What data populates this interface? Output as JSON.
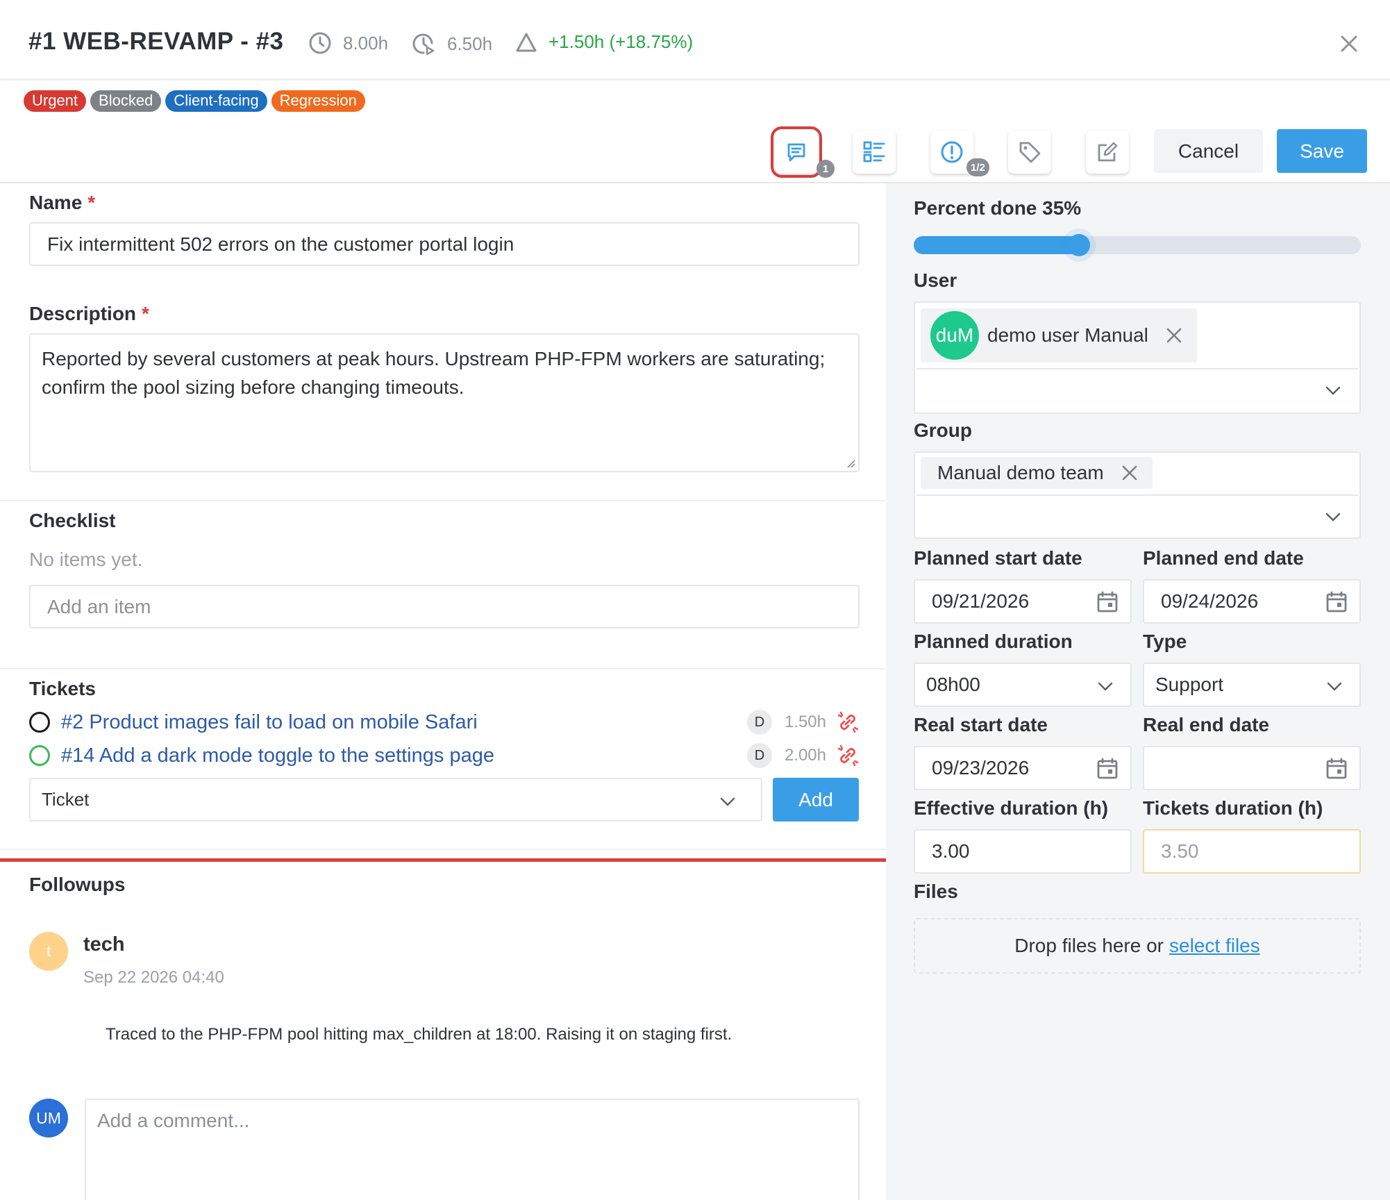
{
  "header": {
    "title": "#1 WEB-REVAMP - #3",
    "planned_time": "8.00h",
    "actual_time": "6.50h",
    "diff": "+1.50h (+18.75%)"
  },
  "tags": [
    {
      "label": "Urgent",
      "color": "#d63a32"
    },
    {
      "label": "Blocked",
      "color": "#7d8288"
    },
    {
      "label": "Client-facing",
      "color": "#1f6fc0"
    },
    {
      "label": "Regression",
      "color": "#f06a1d"
    }
  ],
  "toolbar": {
    "followups_badge": "1",
    "alerts_badge": "1/2",
    "cancel_label": "Cancel",
    "save_label": "Save"
  },
  "form": {
    "name_label": "Name",
    "required_mark": "*",
    "name_value": "Fix intermittent 502 errors on the customer portal login",
    "description_label": "Description",
    "description_value": "Reported by several customers at peak hours. Upstream PHP-FPM workers are saturating; confirm the pool sizing before changing timeouts."
  },
  "checklist": {
    "title": "Checklist",
    "empty": "No items yet.",
    "placeholder": "Add an item"
  },
  "tickets": {
    "title": "Tickets",
    "items": [
      {
        "label": "#2 Product images fail to load on mobile Safari",
        "badge": "D",
        "hours": "1.50h",
        "status_color": "#1b1b1b"
      },
      {
        "label": "#14 Add a dark mode toggle to the settings page",
        "badge": "D",
        "hours": "2.00h",
        "status_color": "#3cb95a"
      }
    ],
    "select_value": "Ticket",
    "add_label": "Add"
  },
  "followups": {
    "title": "Followups",
    "items": [
      {
        "avatar": "t",
        "author": "tech",
        "date": "Sep 22 2026 04:40",
        "text": "Traced to the PHP-FPM pool hitting max_children at 18:00. Raising it on staging first."
      }
    ],
    "comment_avatar": "UM",
    "comment_placeholder": "Add a comment..."
  },
  "side": {
    "percent_label": "Percent done 35%",
    "percent_value": 35,
    "user_label": "User",
    "user_chip": {
      "avatar": "duM",
      "name": "demo user Manual"
    },
    "group_label": "Group",
    "group_chip": "Manual demo team",
    "planned_start_label": "Planned start date",
    "planned_start_value": "09/21/2026",
    "planned_end_label": "Planned end date",
    "planned_end_value": "09/24/2026",
    "planned_duration_label": "Planned duration",
    "planned_duration_value": "08h00",
    "type_label": "Type",
    "type_value": "Support",
    "real_start_label": "Real start date",
    "real_start_value": "09/23/2026",
    "real_end_label": "Real end date",
    "real_end_value": "",
    "effective_label": "Effective duration (h)",
    "effective_value": "3.00",
    "tickets_duration_label": "Tickets duration (h)",
    "tickets_duration_value": "3.50",
    "files_label": "Files",
    "drop_text": "Drop files here or",
    "select_files": "select files"
  }
}
